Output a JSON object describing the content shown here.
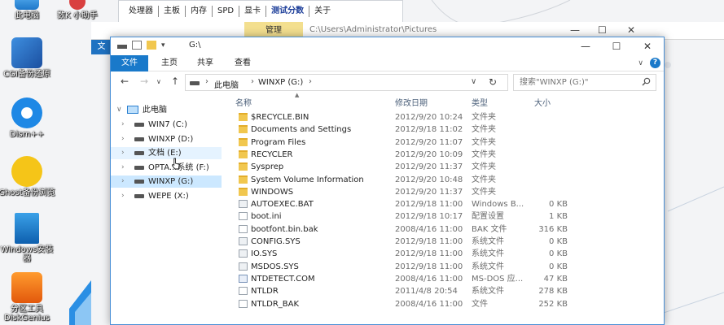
{
  "desktop": {
    "icons": [
      {
        "name": "desk-icon-computer",
        "label": "此电脑"
      },
      {
        "name": "desk-icon-app",
        "label": "数K 小助手"
      },
      {
        "name": "desk-icon-ghost-tool",
        "label": "CGI备份还原"
      },
      {
        "name": "desk-icon-dism",
        "label": "Dism++"
      },
      {
        "name": "desk-icon-ghost-browser",
        "label": "Ghost备份浏览"
      },
      {
        "name": "desk-icon-windows-installer",
        "label": "Windows安装器"
      },
      {
        "name": "desk-icon-diskgenius",
        "label": "分区工具 DiskGenius"
      }
    ]
  },
  "bg_tool": {
    "tabs": [
      "处理器",
      "主板",
      "内存",
      "SPD",
      "显卡",
      "测试分数",
      "关于"
    ],
    "active_index": 5
  },
  "bg_explorer": {
    "manage_label": "管理",
    "path": "C:\\Users\\Administrator\\Pictures",
    "file_tab": "文"
  },
  "window": {
    "title": "G:\\",
    "ribbon_tabs": [
      "文件",
      "主页",
      "共享",
      "查看"
    ],
    "address": {
      "crumbs": [
        "此电脑",
        "WINXP (G:)"
      ]
    },
    "search_placeholder": "搜索\"WINXP (G:)\"",
    "nav_pane": {
      "root": "此电脑",
      "items": [
        {
          "label": "WIN7 (C:)",
          "state": ""
        },
        {
          "label": "WINXP (D:)",
          "state": ""
        },
        {
          "label": "文档 (E:)",
          "state": "hover"
        },
        {
          "label": "OPTA...系统 (F:)",
          "state": ""
        },
        {
          "label": "WINXP (G:)",
          "state": "selected"
        },
        {
          "label": "WEPE (X:)",
          "state": ""
        }
      ]
    },
    "columns": [
      "名称",
      "修改日期",
      "类型",
      "大小"
    ],
    "files": [
      {
        "name": "$RECYCLE.BIN",
        "date": "2012/9/20 10:24",
        "type": "文件夹",
        "size": "",
        "icon": "folder"
      },
      {
        "name": "Documents and Settings",
        "date": "2012/9/18 11:02",
        "type": "文件夹",
        "size": "",
        "icon": "folder"
      },
      {
        "name": "Program Files",
        "date": "2012/9/20 11:07",
        "type": "文件夹",
        "size": "",
        "icon": "folder"
      },
      {
        "name": "RECYCLER",
        "date": "2012/9/20 10:09",
        "type": "文件夹",
        "size": "",
        "icon": "folder"
      },
      {
        "name": "Sysprep",
        "date": "2012/9/20 11:37",
        "type": "文件夹",
        "size": "",
        "icon": "folder"
      },
      {
        "name": "System Volume Information",
        "date": "2012/9/20 10:48",
        "type": "文件夹",
        "size": "",
        "icon": "folder"
      },
      {
        "name": "WINDOWS",
        "date": "2012/9/20 11:37",
        "type": "文件夹",
        "size": "",
        "icon": "folder"
      },
      {
        "name": "AUTOEXEC.BAT",
        "date": "2012/9/18 11:00",
        "type": "Windows B...",
        "size": "0 KB",
        "icon": "sys"
      },
      {
        "name": "boot.ini",
        "date": "2012/9/18 10:17",
        "type": "配置设置",
        "size": "1 KB",
        "icon": "file"
      },
      {
        "name": "bootfont.bin.bak",
        "date": "2008/4/16 11:00",
        "type": "BAK 文件",
        "size": "316 KB",
        "icon": "file"
      },
      {
        "name": "CONFIG.SYS",
        "date": "2012/9/18 11:00",
        "type": "系统文件",
        "size": "0 KB",
        "icon": "sys"
      },
      {
        "name": "IO.SYS",
        "date": "2012/9/18 11:00",
        "type": "系统文件",
        "size": "0 KB",
        "icon": "sys"
      },
      {
        "name": "MSDOS.SYS",
        "date": "2012/9/18 11:00",
        "type": "系统文件",
        "size": "0 KB",
        "icon": "sys"
      },
      {
        "name": "NTDETECT.COM",
        "date": "2008/4/16 11:00",
        "type": "MS-DOS 应...",
        "size": "47 KB",
        "icon": "exe"
      },
      {
        "name": "NTLDR",
        "date": "2011/4/8 20:54",
        "type": "系统文件",
        "size": "278 KB",
        "icon": "file"
      },
      {
        "name": "NTLDR_BAK",
        "date": "2008/4/16 11:00",
        "type": "文件",
        "size": "252 KB",
        "icon": "file"
      }
    ]
  },
  "colors": {
    "accent": "#1979ca",
    "selected": "#cce8ff",
    "hover": "#e5f3ff",
    "folder": "#f1c74f"
  }
}
